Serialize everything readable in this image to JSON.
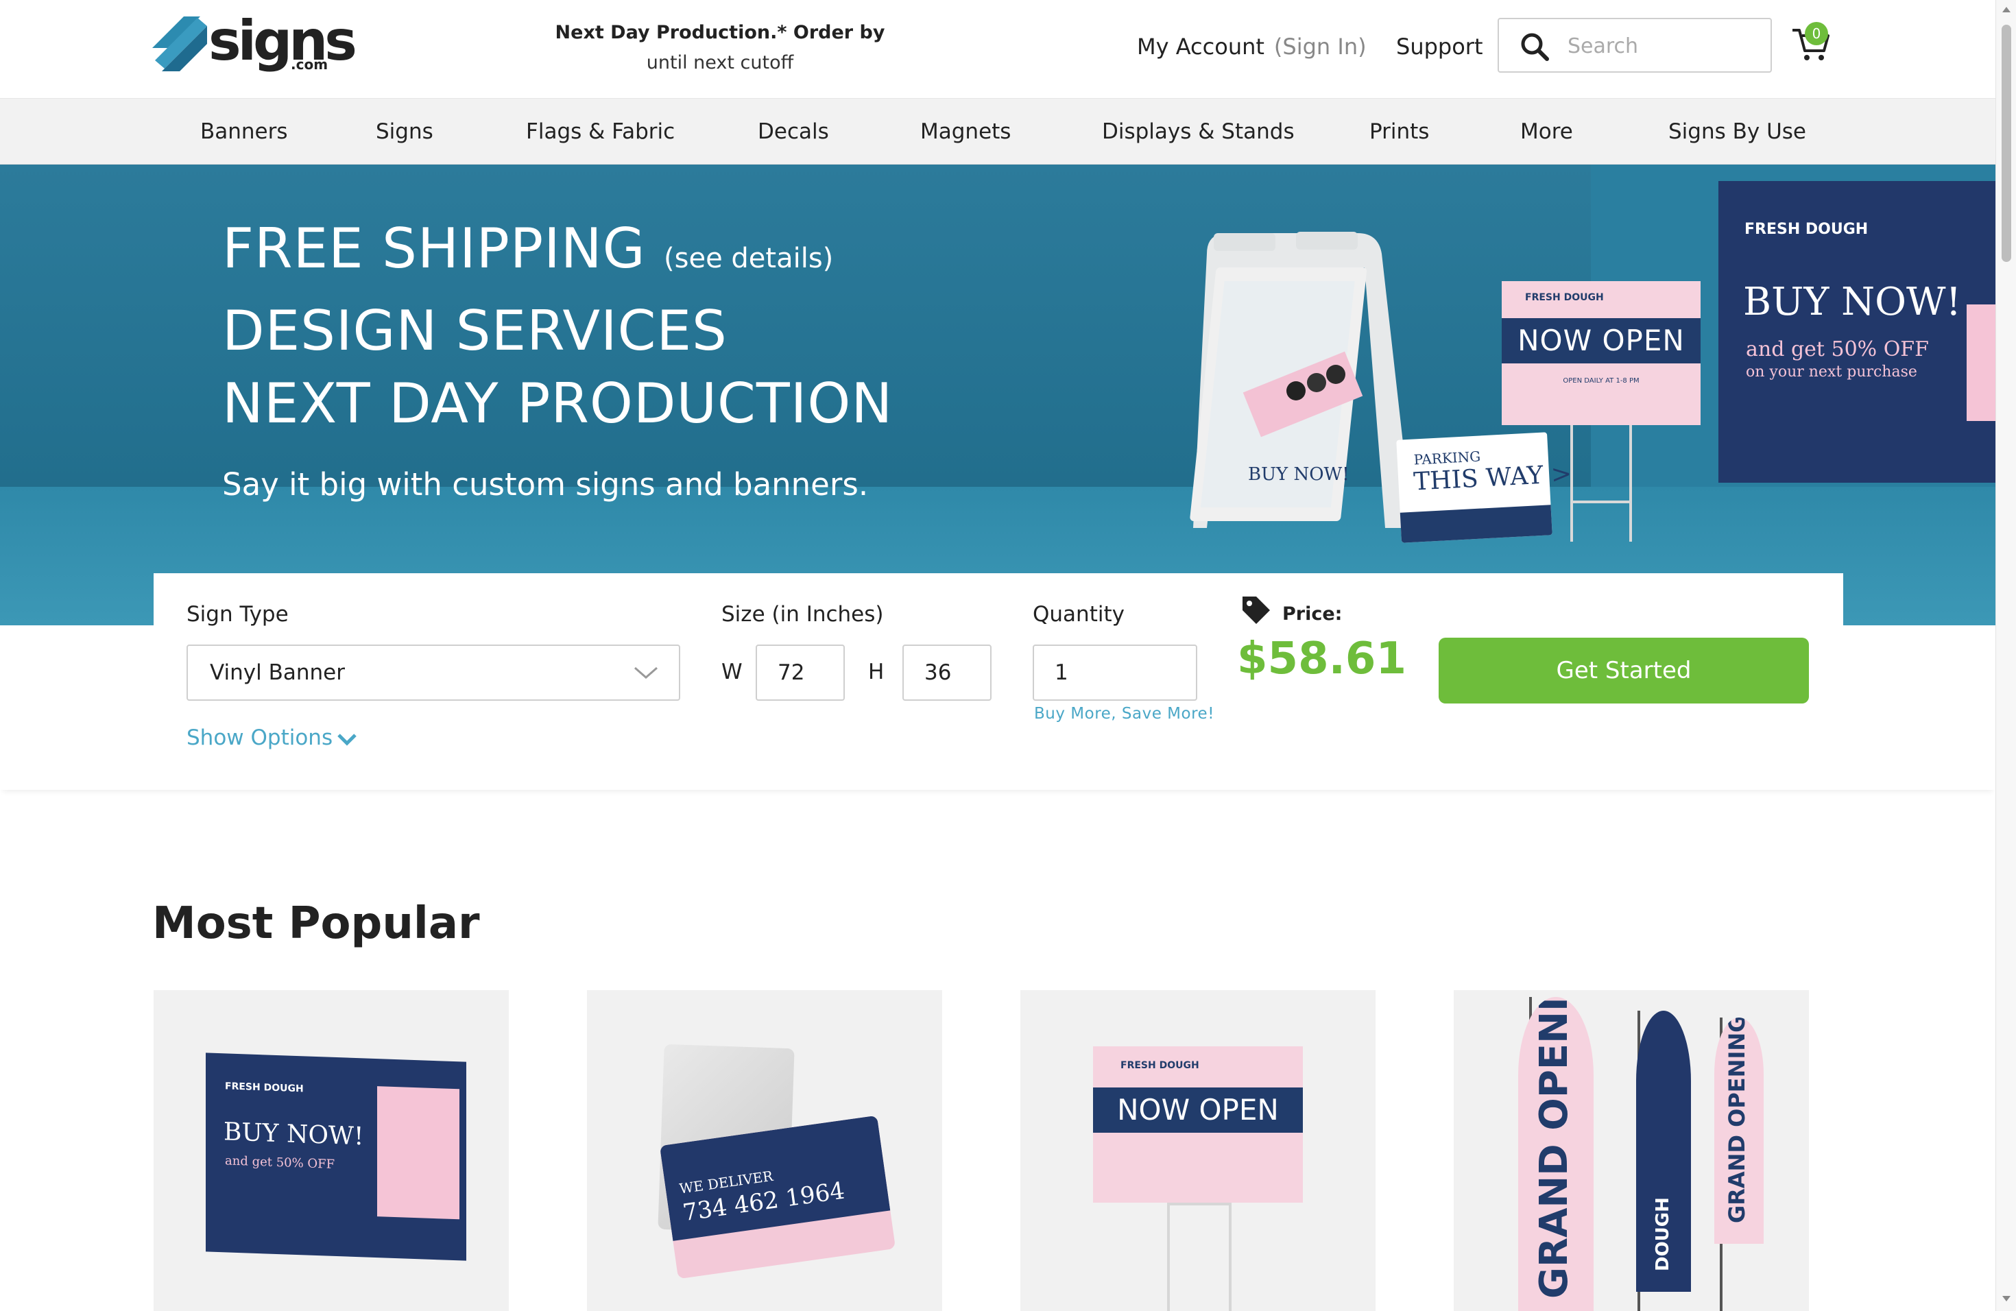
{
  "header": {
    "logo_text": "signs",
    "logo_suffix": ".com",
    "promo_line1": "Next Day Production.* Order by",
    "promo_line2": "until next cutoff",
    "account_label": "My Account",
    "signin_label": "(Sign In)",
    "support_label": "Support",
    "search_placeholder": "Search",
    "cart_count": "0"
  },
  "nav": {
    "items": [
      "Banners",
      "Signs",
      "Flags & Fabric",
      "Decals",
      "Magnets",
      "Displays & Stands",
      "Prints",
      "More",
      "Signs By Use"
    ]
  },
  "hero": {
    "line1": "FREE SHIPPING",
    "line1_details": "(see details)",
    "line2": "DESIGN SERVICES",
    "line3": "NEXT DAY PRODUCTION",
    "subtitle": "Say it big with custom signs and banners.",
    "aframe_text": "BUY NOW!",
    "yard_sign_text": "NOW OPEN",
    "yard_sign_logo": "FRESH DOUGH",
    "yard_sign_small": "OPEN DAILY AT 1-8 PM",
    "parking_line1": "PARKING",
    "parking_line2": "THIS WAY >",
    "wall_logo": "FRESH DOUGH",
    "wall_title": "BUY NOW!",
    "wall_offer": "and get 50% OFF",
    "wall_next": "on your next purchase"
  },
  "configurator": {
    "sign_type_label": "Sign Type",
    "sign_type_value": "Vinyl Banner",
    "show_options_label": "Show Options",
    "size_label": "Size (in Inches)",
    "width_letter": "W",
    "height_letter": "H",
    "width_value": "72",
    "height_value": "36",
    "quantity_label": "Quantity",
    "quantity_value": "1",
    "buy_more_label": "Buy More, Save More!",
    "price_label": "Price:",
    "price_value": "$58.61",
    "cta_label": "Get Started"
  },
  "most_popular": {
    "title": "Most Popular",
    "cards": [
      {
        "name": "vinyl-banner",
        "t0": "FRESH DOUGH",
        "t1": "BUY NOW!",
        "t2": "and get 50% OFF"
      },
      {
        "name": "aluminum-sign",
        "t1": "WE DELIVER",
        "t2": "734 462 1964"
      },
      {
        "name": "yard-sign",
        "t0": "FRESH DOUGH",
        "t1": "NOW OPEN"
      },
      {
        "name": "feather-flag",
        "t1": "GRAND OPENING",
        "t2": "DOUGH",
        "t3": "GRAND OPENING"
      }
    ]
  },
  "colors": {
    "brand_green": "#6ebd3b",
    "link_blue": "#4aa7c7",
    "hero_blue": "#23708f",
    "navy": "#213c6b",
    "pink": "#f6d3df"
  },
  "icons": {
    "search": "search-icon",
    "cart": "cart-icon",
    "price_tag": "price-tag-icon",
    "dropdown": "chevron-down-icon"
  }
}
